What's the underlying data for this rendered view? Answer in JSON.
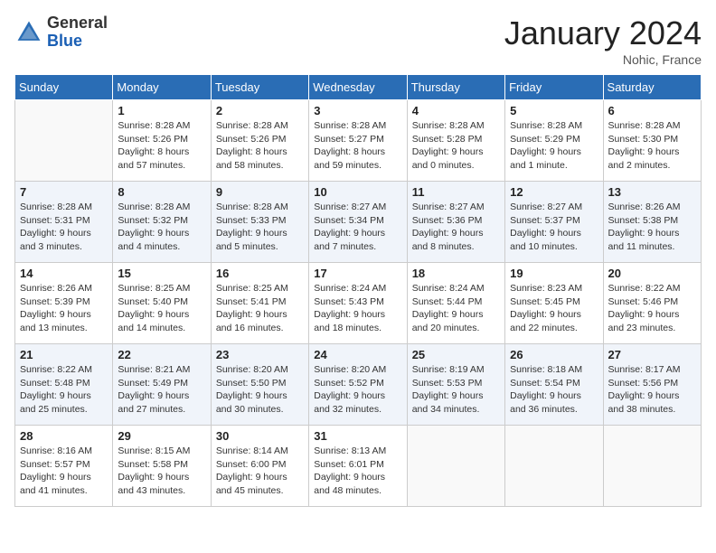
{
  "header": {
    "logo_general": "General",
    "logo_blue": "Blue",
    "month_title": "January 2024",
    "location": "Nohic, France"
  },
  "weekdays": [
    "Sunday",
    "Monday",
    "Tuesday",
    "Wednesday",
    "Thursday",
    "Friday",
    "Saturday"
  ],
  "weeks": [
    [
      {
        "day": "",
        "info": ""
      },
      {
        "day": "1",
        "info": "Sunrise: 8:28 AM\nSunset: 5:26 PM\nDaylight: 8 hours\nand 57 minutes."
      },
      {
        "day": "2",
        "info": "Sunrise: 8:28 AM\nSunset: 5:26 PM\nDaylight: 8 hours\nand 58 minutes."
      },
      {
        "day": "3",
        "info": "Sunrise: 8:28 AM\nSunset: 5:27 PM\nDaylight: 8 hours\nand 59 minutes."
      },
      {
        "day": "4",
        "info": "Sunrise: 8:28 AM\nSunset: 5:28 PM\nDaylight: 9 hours\nand 0 minutes."
      },
      {
        "day": "5",
        "info": "Sunrise: 8:28 AM\nSunset: 5:29 PM\nDaylight: 9 hours\nand 1 minute."
      },
      {
        "day": "6",
        "info": "Sunrise: 8:28 AM\nSunset: 5:30 PM\nDaylight: 9 hours\nand 2 minutes."
      }
    ],
    [
      {
        "day": "7",
        "info": "Sunrise: 8:28 AM\nSunset: 5:31 PM\nDaylight: 9 hours\nand 3 minutes."
      },
      {
        "day": "8",
        "info": "Sunrise: 8:28 AM\nSunset: 5:32 PM\nDaylight: 9 hours\nand 4 minutes."
      },
      {
        "day": "9",
        "info": "Sunrise: 8:28 AM\nSunset: 5:33 PM\nDaylight: 9 hours\nand 5 minutes."
      },
      {
        "day": "10",
        "info": "Sunrise: 8:27 AM\nSunset: 5:34 PM\nDaylight: 9 hours\nand 7 minutes."
      },
      {
        "day": "11",
        "info": "Sunrise: 8:27 AM\nSunset: 5:36 PM\nDaylight: 9 hours\nand 8 minutes."
      },
      {
        "day": "12",
        "info": "Sunrise: 8:27 AM\nSunset: 5:37 PM\nDaylight: 9 hours\nand 10 minutes."
      },
      {
        "day": "13",
        "info": "Sunrise: 8:26 AM\nSunset: 5:38 PM\nDaylight: 9 hours\nand 11 minutes."
      }
    ],
    [
      {
        "day": "14",
        "info": "Sunrise: 8:26 AM\nSunset: 5:39 PM\nDaylight: 9 hours\nand 13 minutes."
      },
      {
        "day": "15",
        "info": "Sunrise: 8:25 AM\nSunset: 5:40 PM\nDaylight: 9 hours\nand 14 minutes."
      },
      {
        "day": "16",
        "info": "Sunrise: 8:25 AM\nSunset: 5:41 PM\nDaylight: 9 hours\nand 16 minutes."
      },
      {
        "day": "17",
        "info": "Sunrise: 8:24 AM\nSunset: 5:43 PM\nDaylight: 9 hours\nand 18 minutes."
      },
      {
        "day": "18",
        "info": "Sunrise: 8:24 AM\nSunset: 5:44 PM\nDaylight: 9 hours\nand 20 minutes."
      },
      {
        "day": "19",
        "info": "Sunrise: 8:23 AM\nSunset: 5:45 PM\nDaylight: 9 hours\nand 22 minutes."
      },
      {
        "day": "20",
        "info": "Sunrise: 8:22 AM\nSunset: 5:46 PM\nDaylight: 9 hours\nand 23 minutes."
      }
    ],
    [
      {
        "day": "21",
        "info": "Sunrise: 8:22 AM\nSunset: 5:48 PM\nDaylight: 9 hours\nand 25 minutes."
      },
      {
        "day": "22",
        "info": "Sunrise: 8:21 AM\nSunset: 5:49 PM\nDaylight: 9 hours\nand 27 minutes."
      },
      {
        "day": "23",
        "info": "Sunrise: 8:20 AM\nSunset: 5:50 PM\nDaylight: 9 hours\nand 30 minutes."
      },
      {
        "day": "24",
        "info": "Sunrise: 8:20 AM\nSunset: 5:52 PM\nDaylight: 9 hours\nand 32 minutes."
      },
      {
        "day": "25",
        "info": "Sunrise: 8:19 AM\nSunset: 5:53 PM\nDaylight: 9 hours\nand 34 minutes."
      },
      {
        "day": "26",
        "info": "Sunrise: 8:18 AM\nSunset: 5:54 PM\nDaylight: 9 hours\nand 36 minutes."
      },
      {
        "day": "27",
        "info": "Sunrise: 8:17 AM\nSunset: 5:56 PM\nDaylight: 9 hours\nand 38 minutes."
      }
    ],
    [
      {
        "day": "28",
        "info": "Sunrise: 8:16 AM\nSunset: 5:57 PM\nDaylight: 9 hours\nand 41 minutes."
      },
      {
        "day": "29",
        "info": "Sunrise: 8:15 AM\nSunset: 5:58 PM\nDaylight: 9 hours\nand 43 minutes."
      },
      {
        "day": "30",
        "info": "Sunrise: 8:14 AM\nSunset: 6:00 PM\nDaylight: 9 hours\nand 45 minutes."
      },
      {
        "day": "31",
        "info": "Sunrise: 8:13 AM\nSunset: 6:01 PM\nDaylight: 9 hours\nand 48 minutes."
      },
      {
        "day": "",
        "info": ""
      },
      {
        "day": "",
        "info": ""
      },
      {
        "day": "",
        "info": ""
      }
    ]
  ]
}
